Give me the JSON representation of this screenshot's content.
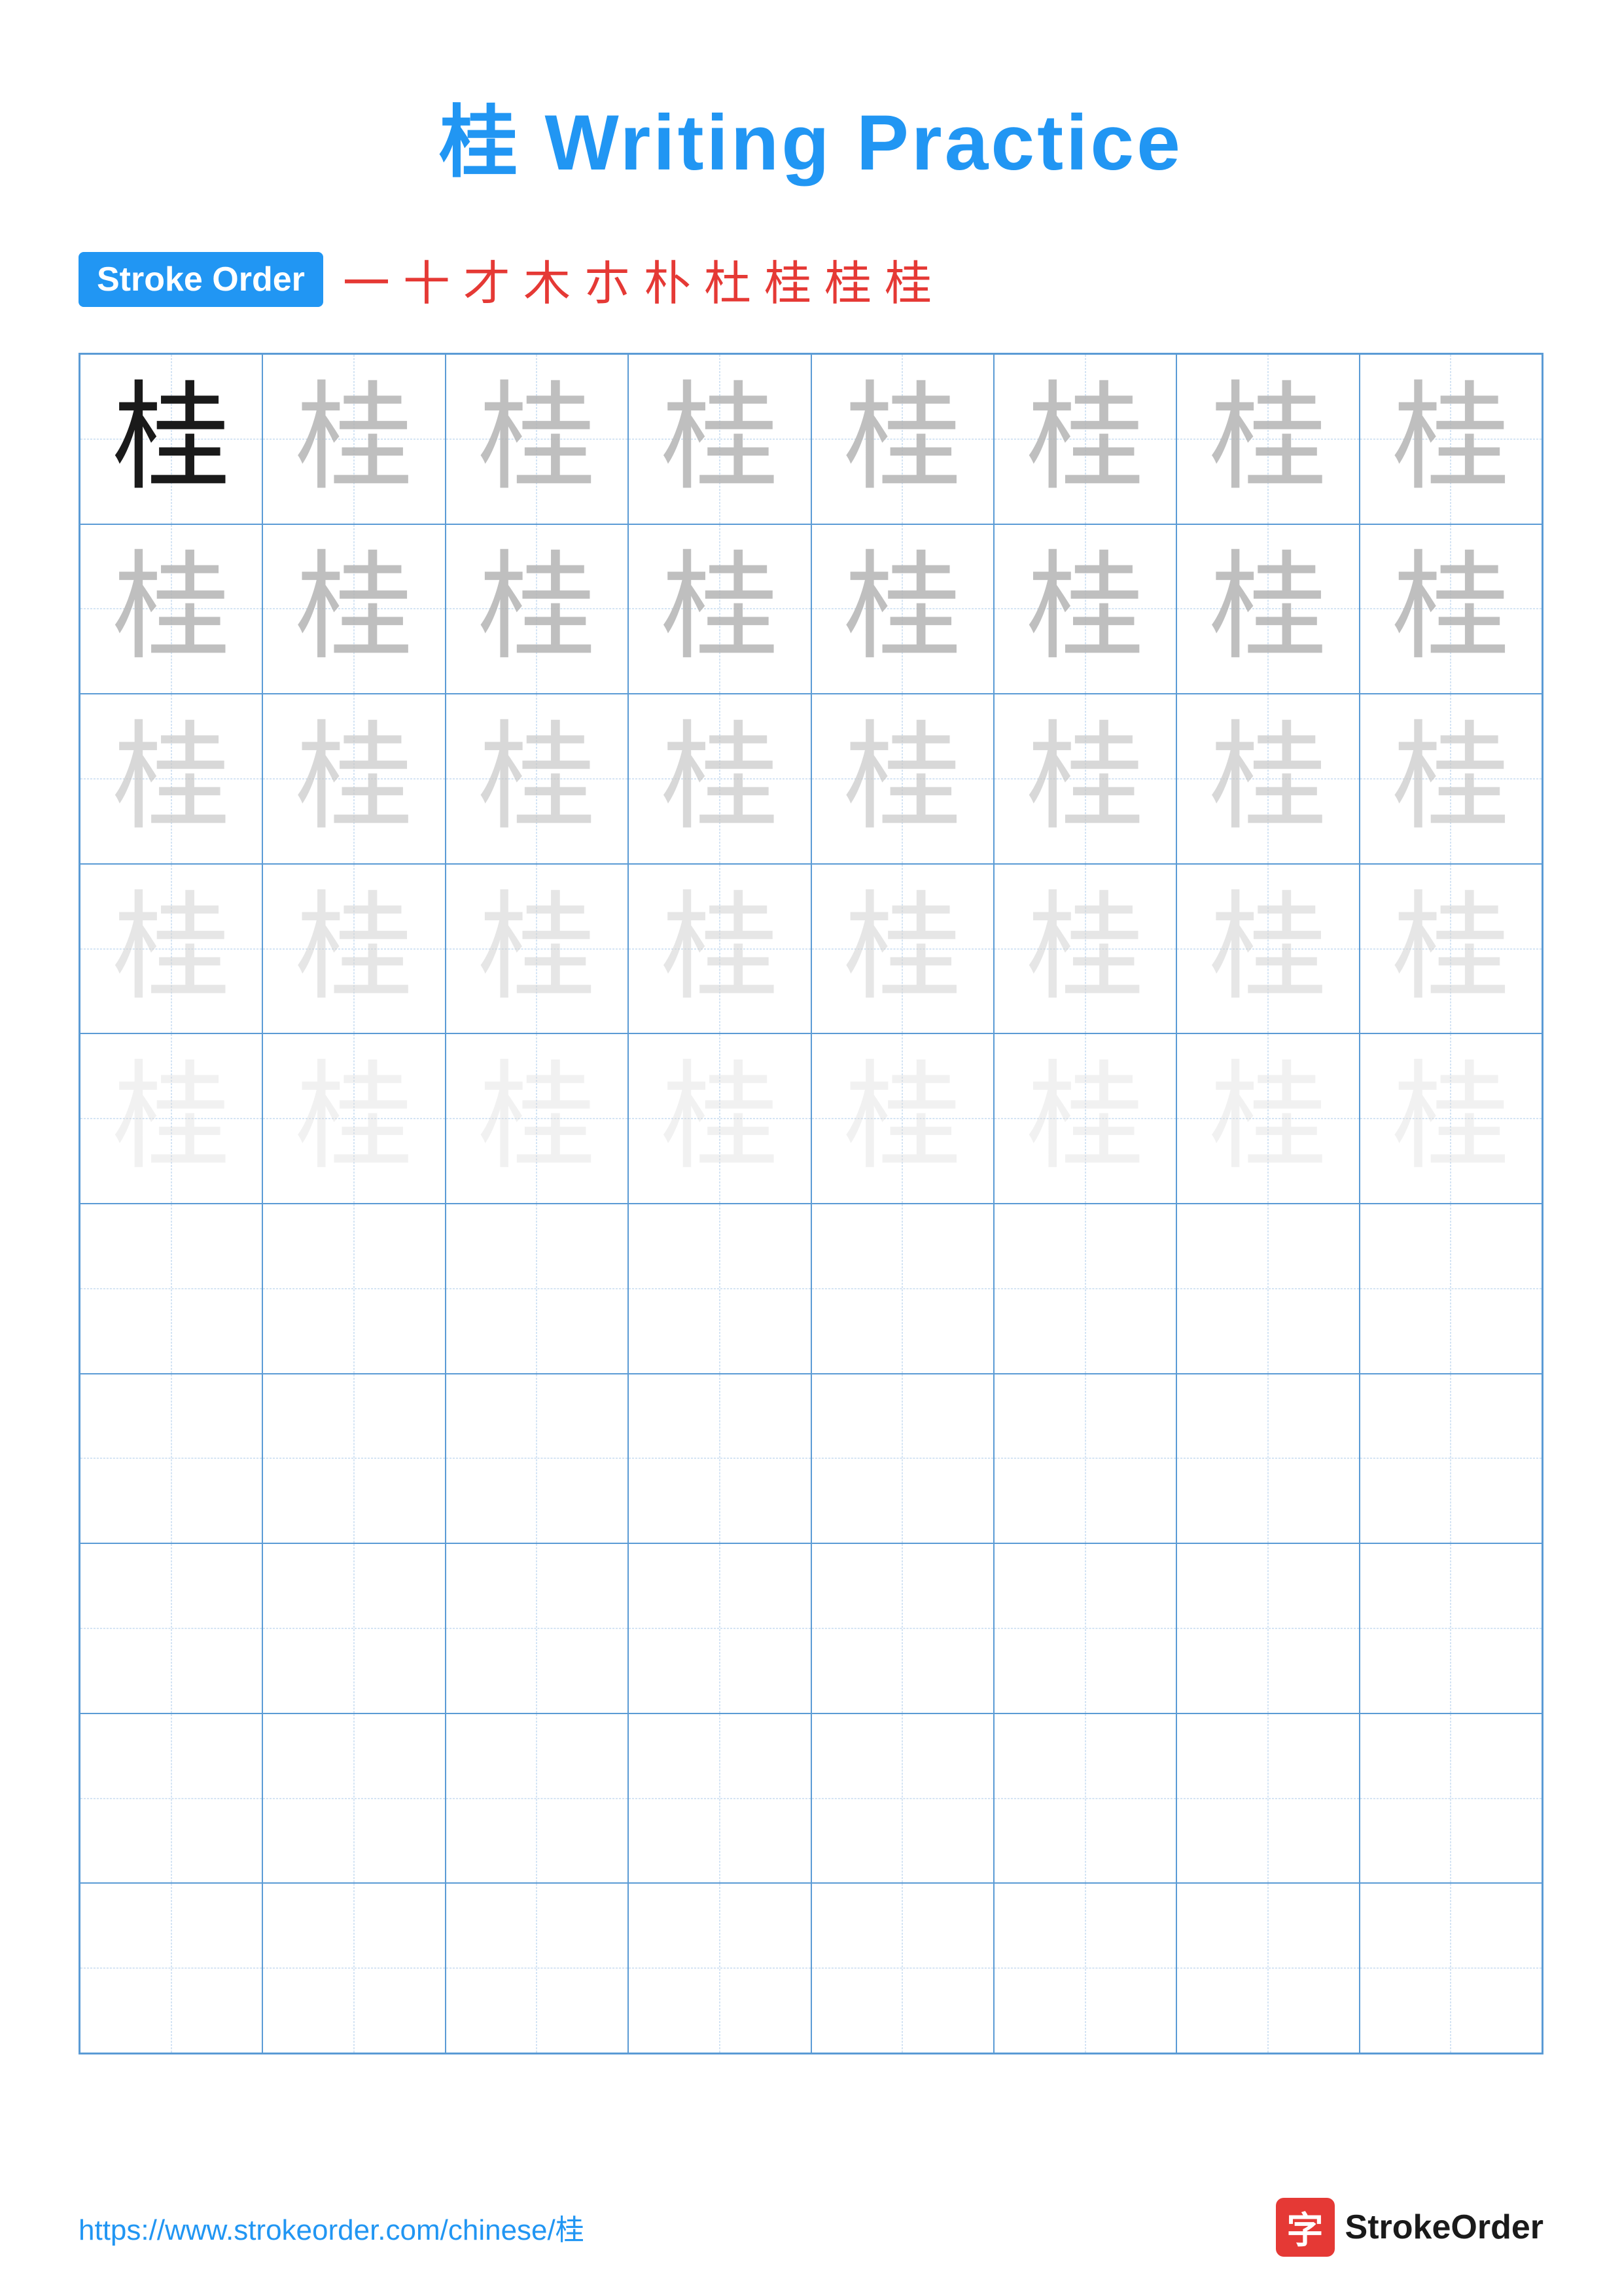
{
  "title": {
    "char": "桂",
    "rest": " Writing Practice"
  },
  "stroke_order": {
    "badge_label": "Stroke Order",
    "strokes": [
      "一",
      "十",
      "才",
      "木",
      "木",
      "朴",
      "杜",
      "桂",
      "桂",
      "桂"
    ]
  },
  "character": "桂",
  "rows": [
    {
      "type": "solid_then_light",
      "opacities": [
        "solid",
        "light1",
        "light1",
        "light1",
        "light1",
        "light1",
        "light1",
        "light1"
      ]
    },
    {
      "type": "light",
      "opacities": [
        "light1",
        "light1",
        "light1",
        "light1",
        "light1",
        "light1",
        "light1",
        "light1"
      ]
    },
    {
      "type": "light",
      "opacities": [
        "light2",
        "light2",
        "light2",
        "light2",
        "light2",
        "light2",
        "light2",
        "light2"
      ]
    },
    {
      "type": "light",
      "opacities": [
        "light3",
        "light3",
        "light3",
        "light3",
        "light3",
        "light3",
        "light3",
        "light3"
      ]
    },
    {
      "type": "light",
      "opacities": [
        "light4",
        "light4",
        "light4",
        "light4",
        "light4",
        "light4",
        "light4",
        "light4"
      ]
    },
    {
      "type": "empty"
    },
    {
      "type": "empty"
    },
    {
      "type": "empty"
    },
    {
      "type": "empty"
    },
    {
      "type": "empty"
    }
  ],
  "footer": {
    "url": "https://www.strokeorder.com/chinese/桂",
    "logo_char": "字",
    "logo_text": "StrokeOrder"
  }
}
